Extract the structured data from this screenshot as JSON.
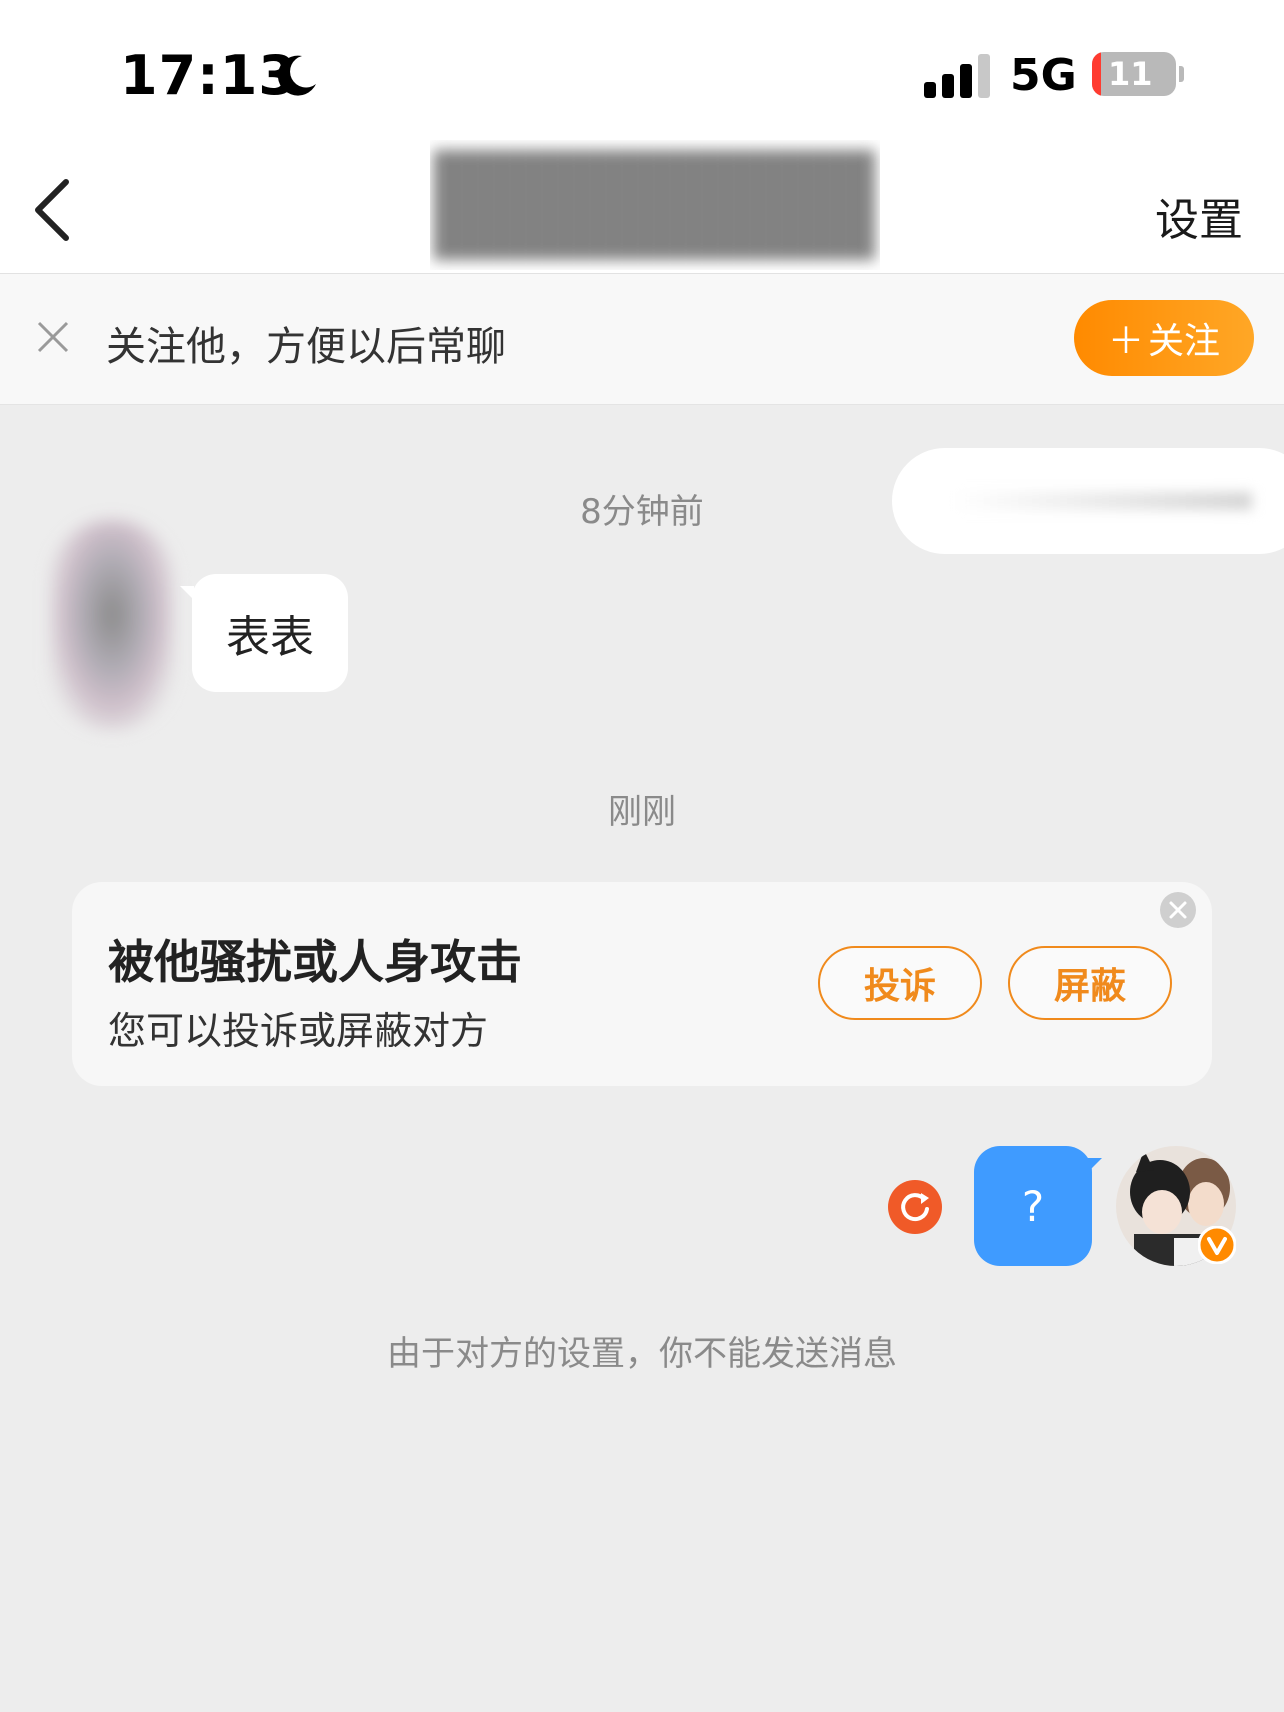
{
  "status_bar": {
    "time": "17:13",
    "network": "5G",
    "battery_level": "11",
    "battery_fraction": 0.11
  },
  "nav": {
    "settings_label": "设置"
  },
  "follow_banner": {
    "text": "关注他，方便以后常聊",
    "button_label": "关注",
    "button_plus": "＋"
  },
  "chat": {
    "timestamp_1": "8分钟前",
    "received_message": "表表",
    "timestamp_2": "刚刚",
    "sent_message": "?"
  },
  "report_card": {
    "title": "被他骚扰或人身攻击",
    "subtitle": "您可以投诉或屏蔽对方",
    "complain_label": "投诉",
    "block_label": "屏蔽"
  },
  "system_notice": "由于对方的设置，你不能发送消息",
  "colors": {
    "accent_orange": "#ff8a00",
    "sent_bubble": "#3f9bff",
    "retry_red": "#f05a28",
    "background": "#ededed"
  },
  "icons": {
    "moon": "moon-icon",
    "signal": "signal-icon",
    "battery": "battery-icon",
    "back": "chevron-left-icon",
    "banner_close": "close-icon",
    "report_close": "close-circle-icon",
    "retry": "retry-icon",
    "verified": "verified-badge-icon"
  }
}
